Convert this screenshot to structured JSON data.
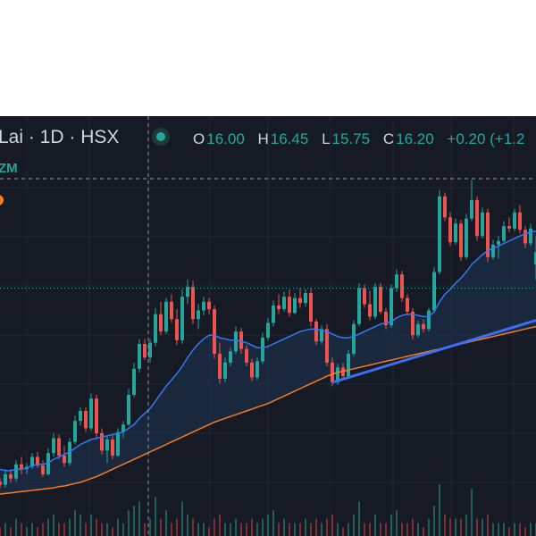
{
  "header": {
    "symbol_title": "Lai · 1D · HSX",
    "market_status_color": "#26a69a",
    "ohlc": {
      "open_label": "O",
      "open_value": "16.00",
      "high_label": "H",
      "high_value": "16.45",
      "low_label": "L",
      "low_value": "15.75",
      "close_label": "C",
      "close_value": "16.20",
      "change": "+0.20 (+1.2"
    }
  },
  "indicator_label": "ZM",
  "colors": {
    "background": "#161a25",
    "panel_top": "#ffffff",
    "up": "#26a69a",
    "down": "#ef5350",
    "ma_short": "#3179f5",
    "ma_long": "#f57c20",
    "trendline": "#3d6df2",
    "text": "#d1d4dc"
  },
  "chart_data": {
    "type": "candlestick",
    "title": "",
    "xlabel": "",
    "ylabel": "",
    "ylim": [
      12.2,
      17.6
    ],
    "grid": true,
    "series_ohlc": [
      [
        12.5,
        12.56,
        12.4,
        12.45
      ],
      [
        12.45,
        12.7,
        12.4,
        12.62
      ],
      [
        12.62,
        12.7,
        12.48,
        12.55
      ],
      [
        12.55,
        12.85,
        12.5,
        12.78
      ],
      [
        12.78,
        12.9,
        12.62,
        12.7
      ],
      [
        12.7,
        12.8,
        12.62,
        12.74
      ],
      [
        12.74,
        12.96,
        12.7,
        12.9
      ],
      [
        12.9,
        12.98,
        12.72,
        12.76
      ],
      [
        12.76,
        12.84,
        12.58,
        12.62
      ],
      [
        12.62,
        13.04,
        12.6,
        12.96
      ],
      [
        12.96,
        13.28,
        12.9,
        13.2
      ],
      [
        13.2,
        13.26,
        12.86,
        12.92
      ],
      [
        12.92,
        13.08,
        12.74,
        12.8
      ],
      [
        12.8,
        13.2,
        12.76,
        13.14
      ],
      [
        13.14,
        13.56,
        13.1,
        13.48
      ],
      [
        13.48,
        13.7,
        13.4,
        13.64
      ],
      [
        13.64,
        13.7,
        13.3,
        13.36
      ],
      [
        13.36,
        13.92,
        13.32,
        13.84
      ],
      [
        13.84,
        13.9,
        13.2,
        13.28
      ],
      [
        13.28,
        13.36,
        12.94,
        13.0
      ],
      [
        13.0,
        13.24,
        12.8,
        13.18
      ],
      [
        13.18,
        13.26,
        12.86,
        12.92
      ],
      [
        12.92,
        13.36,
        12.9,
        13.3
      ],
      [
        13.3,
        13.48,
        13.2,
        13.42
      ],
      [
        13.42,
        14.0,
        13.4,
        13.9
      ],
      [
        13.9,
        14.42,
        13.86,
        14.32
      ],
      [
        14.32,
        14.8,
        14.26,
        14.72
      ],
      [
        14.72,
        14.8,
        14.46,
        14.5
      ],
      [
        14.5,
        14.8,
        14.42,
        14.74
      ],
      [
        14.74,
        15.3,
        14.68,
        15.2
      ],
      [
        15.2,
        15.4,
        14.86,
        14.92
      ],
      [
        14.92,
        15.46,
        14.88,
        15.4
      ],
      [
        15.4,
        15.52,
        15.06,
        15.12
      ],
      [
        15.12,
        15.28,
        14.7,
        14.78
      ],
      [
        14.78,
        15.6,
        14.72,
        15.48
      ],
      [
        15.48,
        15.76,
        15.36,
        15.64
      ],
      [
        15.64,
        15.74,
        15.04,
        15.12
      ],
      [
        15.12,
        15.36,
        14.96,
        15.26
      ],
      [
        15.26,
        15.48,
        15.18,
        15.4
      ],
      [
        15.4,
        15.46,
        15.2,
        15.28
      ],
      [
        15.28,
        15.34,
        14.48,
        14.56
      ],
      [
        14.56,
        14.74,
        14.08,
        14.16
      ],
      [
        14.16,
        14.5,
        14.1,
        14.42
      ],
      [
        14.42,
        14.66,
        14.36,
        14.6
      ],
      [
        14.6,
        15.0,
        14.56,
        14.92
      ],
      [
        14.92,
        14.98,
        14.56,
        14.64
      ],
      [
        14.64,
        14.7,
        14.36,
        14.42
      ],
      [
        14.42,
        14.48,
        14.12,
        14.18
      ],
      [
        14.18,
        14.5,
        14.14,
        14.44
      ],
      [
        14.44,
        14.9,
        14.4,
        14.82
      ],
      [
        14.82,
        15.14,
        14.78,
        15.06
      ],
      [
        15.06,
        15.42,
        15.0,
        15.34
      ],
      [
        15.34,
        15.52,
        15.2,
        15.28
      ],
      [
        15.28,
        15.56,
        15.24,
        15.48
      ],
      [
        15.48,
        15.6,
        15.16,
        15.22
      ],
      [
        15.22,
        15.54,
        15.2,
        15.46
      ],
      [
        15.46,
        15.62,
        15.3,
        15.38
      ],
      [
        15.38,
        15.6,
        15.32,
        15.54
      ],
      [
        15.54,
        15.62,
        15.0,
        15.08
      ],
      [
        15.08,
        15.12,
        14.7,
        14.76
      ],
      [
        14.76,
        15.02,
        14.72,
        14.96
      ],
      [
        14.96,
        15.04,
        14.36,
        14.42
      ],
      [
        14.42,
        14.5,
        14.04,
        14.1
      ],
      [
        14.1,
        14.4,
        14.06,
        14.34
      ],
      [
        14.34,
        14.42,
        14.14,
        14.2
      ],
      [
        14.2,
        14.62,
        14.16,
        14.56
      ],
      [
        14.56,
        15.1,
        14.52,
        15.04
      ],
      [
        15.04,
        15.7,
        15.0,
        15.62
      ],
      [
        15.62,
        15.68,
        15.3,
        15.36
      ],
      [
        15.36,
        15.58,
        15.1,
        15.16
      ],
      [
        15.16,
        15.7,
        15.12,
        15.64
      ],
      [
        15.64,
        15.7,
        15.2,
        15.24
      ],
      [
        15.24,
        15.3,
        14.96,
        15.02
      ],
      [
        15.02,
        15.68,
        14.98,
        15.62
      ],
      [
        15.62,
        15.92,
        15.56,
        15.84
      ],
      [
        15.84,
        15.9,
        15.4,
        15.46
      ],
      [
        15.46,
        15.52,
        15.18,
        15.24
      ],
      [
        15.24,
        15.3,
        14.8,
        14.86
      ],
      [
        14.86,
        15.1,
        14.82,
        15.04
      ],
      [
        15.04,
        15.12,
        14.9,
        14.96
      ],
      [
        14.96,
        15.3,
        14.92,
        15.26
      ],
      [
        15.26,
        15.96,
        15.22,
        15.88
      ],
      [
        15.88,
        17.2,
        15.84,
        17.1
      ],
      [
        17.1,
        17.16,
        16.7,
        16.76
      ],
      [
        16.76,
        16.84,
        16.3,
        16.36
      ],
      [
        16.36,
        16.74,
        16.32,
        16.66
      ],
      [
        16.66,
        16.72,
        16.06,
        16.12
      ],
      [
        16.12,
        16.82,
        16.08,
        16.74
      ],
      [
        16.74,
        17.36,
        16.7,
        17.04
      ],
      [
        17.04,
        17.1,
        16.38,
        16.46
      ],
      [
        16.46,
        16.92,
        16.42,
        16.84
      ],
      [
        16.84,
        16.9,
        16.04,
        16.12
      ],
      [
        16.12,
        16.4,
        16.08,
        16.32
      ],
      [
        16.32,
        16.46,
        16.1,
        16.38
      ],
      [
        16.38,
        16.7,
        16.34,
        16.62
      ],
      [
        16.62,
        16.76,
        16.52,
        16.58
      ],
      [
        16.58,
        16.9,
        16.54,
        16.84
      ],
      [
        16.84,
        16.96,
        16.5,
        16.56
      ],
      [
        16.56,
        16.62,
        16.26,
        16.34
      ],
      [
        16.34,
        16.66,
        16.3,
        16.58
      ],
      [
        16.0,
        16.45,
        15.75,
        16.2
      ]
    ],
    "ma_short": [
      12.7,
      12.68,
      12.68,
      12.7,
      12.7,
      12.72,
      12.76,
      12.78,
      12.78,
      12.8,
      12.86,
      12.9,
      12.94,
      12.98,
      13.04,
      13.1,
      13.14,
      13.18,
      13.2,
      13.22,
      13.24,
      13.26,
      13.28,
      13.3,
      13.36,
      13.42,
      13.52,
      13.6,
      13.68,
      13.8,
      13.92,
      14.04,
      14.14,
      14.24,
      14.36,
      14.5,
      14.62,
      14.72,
      14.8,
      14.86,
      14.86,
      14.82,
      14.8,
      14.78,
      14.78,
      14.76,
      14.74,
      14.7,
      14.66,
      14.66,
      14.68,
      14.72,
      14.76,
      14.8,
      14.84,
      14.88,
      14.92,
      14.94,
      14.96,
      14.96,
      14.94,
      14.92,
      14.88,
      14.84,
      14.82,
      14.82,
      14.84,
      14.88,
      14.92,
      14.96,
      15.0,
      15.04,
      15.06,
      15.08,
      15.14,
      15.18,
      15.2,
      15.2,
      15.18,
      15.16,
      15.16,
      15.24,
      15.4,
      15.52,
      15.6,
      15.7,
      15.78,
      15.88,
      16.0,
      16.08,
      16.16,
      16.22,
      16.26,
      16.3,
      16.34,
      16.38,
      16.42,
      16.46,
      16.5,
      16.52,
      16.54
    ],
    "ma_long": [
      12.3,
      12.31,
      12.32,
      12.33,
      12.34,
      12.35,
      12.36,
      12.37,
      12.38,
      12.39,
      12.4,
      12.42,
      12.43,
      12.45,
      12.47,
      12.49,
      12.52,
      12.55,
      12.58,
      12.62,
      12.66,
      12.7,
      12.74,
      12.78,
      12.82,
      12.86,
      12.9,
      12.94,
      12.98,
      13.02,
      13.06,
      13.1,
      13.14,
      13.18,
      13.22,
      13.26,
      13.3,
      13.34,
      13.38,
      13.42,
      13.46,
      13.49,
      13.52,
      13.55,
      13.58,
      13.61,
      13.64,
      13.67,
      13.7,
      13.73,
      13.76,
      13.8,
      13.84,
      13.88,
      13.92,
      13.96,
      14.0,
      14.04,
      14.08,
      14.12,
      14.16,
      14.2,
      14.23,
      14.26,
      14.28,
      14.3,
      14.32,
      14.34,
      14.36,
      14.38,
      14.4,
      14.42,
      14.44,
      14.46,
      14.48,
      14.5,
      14.52,
      14.54,
      14.56,
      14.58,
      14.6,
      14.62,
      14.64,
      14.66,
      14.68,
      14.7,
      14.72,
      14.74,
      14.76,
      14.78,
      14.8,
      14.82,
      14.84,
      14.86,
      14.88,
      14.9,
      14.92,
      14.94,
      14.96,
      14.98,
      15.0
    ],
    "trendline": {
      "start_index": 62,
      "start_value": 14.1,
      "end_index": 100,
      "end_value": 15.1
    },
    "price_line": 15.62,
    "volume": [
      0.2,
      0.3,
      0.2,
      0.4,
      0.3,
      0.2,
      0.3,
      0.2,
      0.3,
      0.4,
      0.5,
      0.3,
      0.3,
      0.4,
      0.6,
      0.5,
      0.3,
      0.5,
      0.4,
      0.3,
      0.3,
      0.2,
      0.4,
      0.3,
      0.6,
      0.7,
      0.8,
      0.3,
      0.4,
      0.9,
      0.4,
      0.6,
      0.3,
      0.4,
      0.8,
      0.5,
      0.4,
      0.3,
      0.3,
      0.2,
      0.4,
      0.5,
      0.3,
      0.3,
      0.4,
      0.3,
      0.3,
      0.4,
      0.3,
      0.4,
      0.5,
      0.6,
      0.3,
      0.4,
      0.3,
      0.3,
      0.3,
      0.4,
      0.3,
      0.4,
      0.3,
      0.4,
      0.5,
      0.3,
      0.2,
      0.3,
      0.5,
      0.8,
      0.3,
      0.3,
      0.5,
      0.3,
      0.3,
      0.5,
      0.6,
      0.3,
      0.3,
      0.4,
      0.3,
      0.2,
      0.4,
      0.7,
      1.2,
      0.5,
      0.4,
      0.4,
      0.4,
      0.5,
      1.1,
      0.4,
      0.4,
      0.5,
      0.3,
      0.3,
      0.3,
      0.2,
      0.3,
      0.3,
      0.2,
      0.3,
      0.3
    ],
    "volume_max": 1.2
  }
}
